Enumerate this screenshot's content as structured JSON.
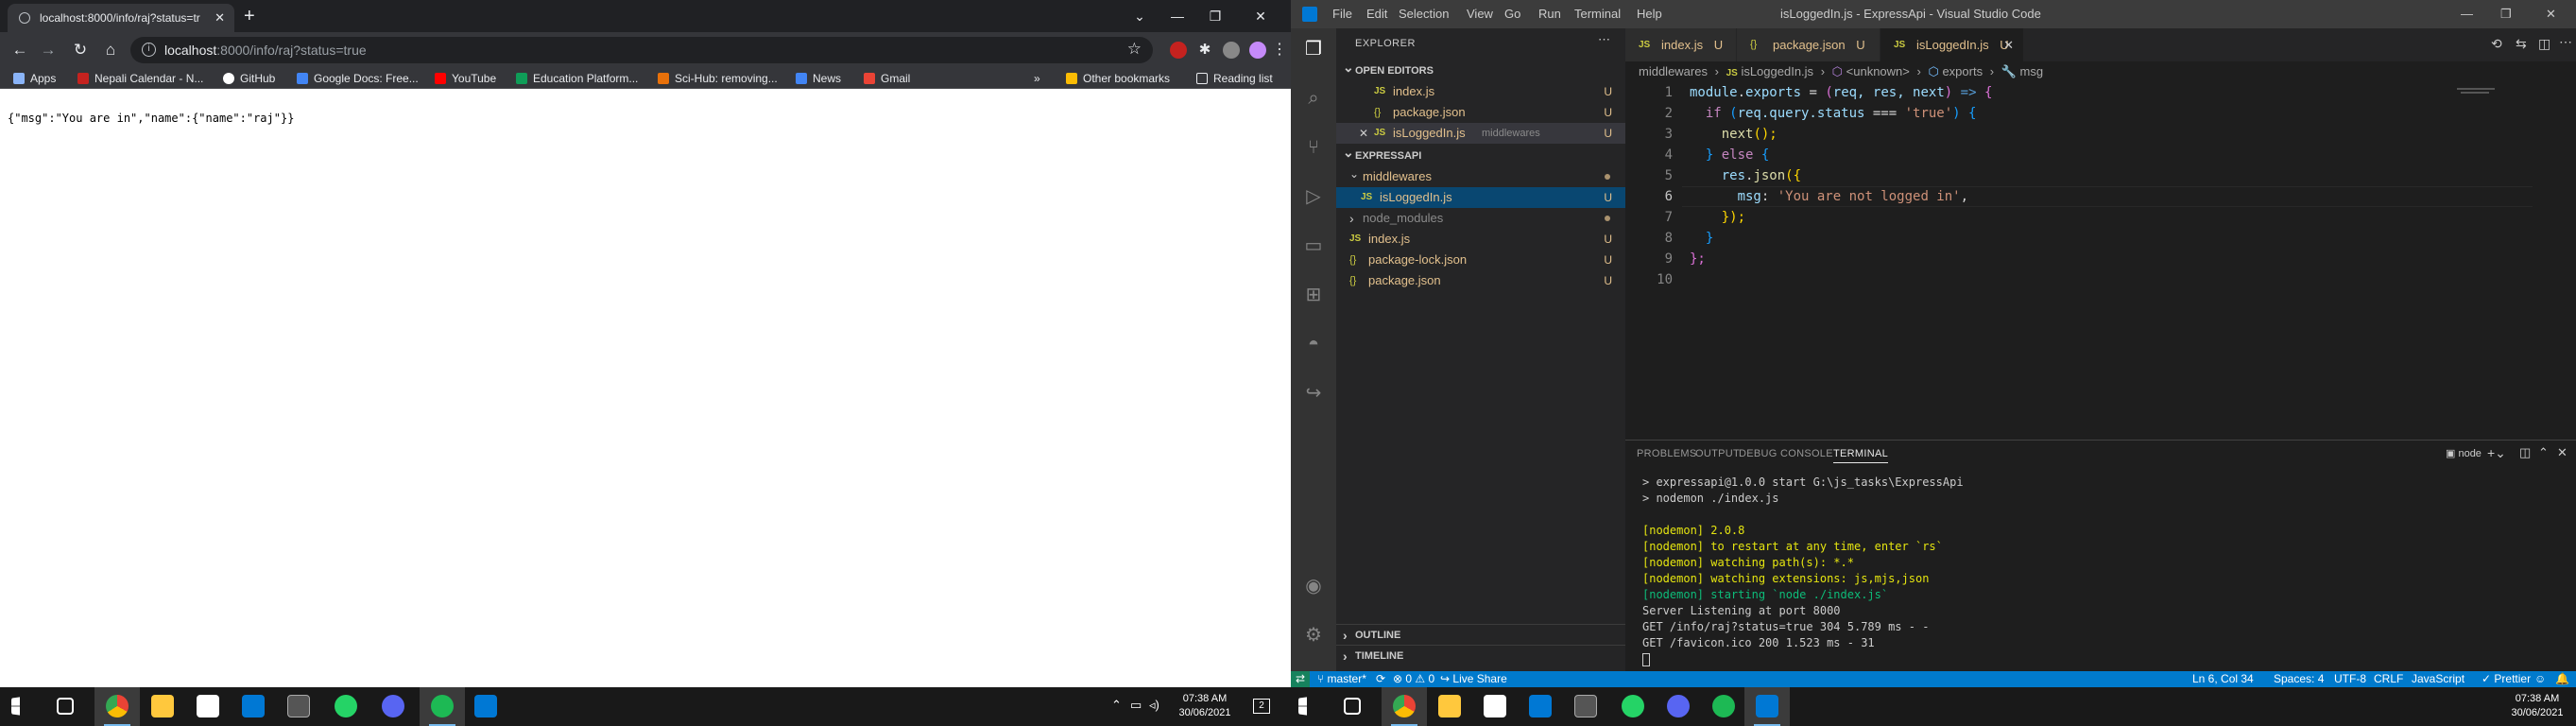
{
  "browser": {
    "tab_title": "localhost:8000/info/raj?status=tr",
    "url_host": "localhost",
    "url_rest": ":8000/info/raj?status=true",
    "bookmarks": [
      {
        "label": "Apps",
        "color": "#8ab4f8"
      },
      {
        "label": "Nepali Calendar - N...",
        "color": "#c5221f"
      },
      {
        "label": "GitHub",
        "color": "#ffffff"
      },
      {
        "label": "Google Docs: Free...",
        "color": "#4285f4"
      },
      {
        "label": "YouTube",
        "color": "#ff0000"
      },
      {
        "label": "Education Platform...",
        "color": "#0f9d58"
      },
      {
        "label": "Sci-Hub: removing...",
        "color": "#e8710a"
      },
      {
        "label": "News",
        "color": "#4285f4"
      },
      {
        "label": "Gmail",
        "color": "#ea4335"
      }
    ],
    "other_bookmarks": "Other bookmarks",
    "reading_list": "Reading list",
    "page_body": "{\"msg\":\"You are in\",\"name\":{\"name\":\"raj\"}}"
  },
  "taskbar_left": {
    "time": "07:38 AM",
    "date": "30/06/2021",
    "notif": "2"
  },
  "taskbar_right": {
    "time": "07:38 AM",
    "date": "30/06/2021"
  },
  "vscode": {
    "title": "isLoggedIn.js - ExpressApi - Visual Studio Code",
    "menu": [
      "File",
      "Edit",
      "Selection",
      "View",
      "Go",
      "Run",
      "Terminal",
      "Help"
    ],
    "explorer_label": "EXPLORER",
    "open_editors_label": "OPEN EDITORS",
    "open_editors": [
      {
        "name": "index.js",
        "type": "JS",
        "badge": "U"
      },
      {
        "name": "package.json",
        "type": "{}",
        "badge": "U"
      },
      {
        "name": "isLoggedIn.js",
        "type": "JS",
        "badge": "U",
        "desc": "middlewares"
      }
    ],
    "project_label": "EXPRESSAPI",
    "tree": [
      {
        "name": "middlewares",
        "type": "folder"
      },
      {
        "name": "isLoggedIn.js",
        "type": "JS",
        "badge": "U"
      },
      {
        "name": "node_modules",
        "type": "folder"
      },
      {
        "name": "index.js",
        "type": "JS",
        "badge": "U"
      },
      {
        "name": "package-lock.json",
        "type": "{}",
        "badge": "U"
      },
      {
        "name": "package.json",
        "type": "{}",
        "badge": "U"
      }
    ],
    "outline_label": "OUTLINE",
    "timeline_label": "TIMELINE",
    "tabs": [
      {
        "name": "index.js",
        "type": "JS",
        "badge": "U"
      },
      {
        "name": "package.json",
        "type": "{}",
        "badge": "U"
      },
      {
        "name": "isLoggedIn.js",
        "type": "JS",
        "badge": "U"
      }
    ],
    "breadcrumb": {
      "folder": "middlewares",
      "file": "isLoggedIn.js",
      "fn": "<unknown>",
      "exports": "exports",
      "msg": "msg"
    },
    "line_numbers": [
      "1",
      "2",
      "3",
      "4",
      "5",
      "6",
      "7",
      "8",
      "9",
      "10"
    ],
    "code": {
      "l1_a": "module",
      "l1_b": ".",
      "l1_c": "exports",
      "l1_d": " = ",
      "l1_e": "(",
      "l1_f": "req, res, next",
      "l1_g": ")",
      "l1_h": " => ",
      "l1_i": "{",
      "l2_a": "if",
      "l2_b": " (",
      "l2_c": "req.query.status",
      "l2_d": " === ",
      "l2_e": "'true'",
      "l2_f": ") {",
      "l3_a": "next",
      "l3_b": "();",
      "l4_a": "} ",
      "l4_b": "else",
      "l4_c": " {",
      "l5_a": "res",
      "l5_b": ".",
      "l5_c": "json",
      "l5_d": "({",
      "l6_a": "msg",
      "l6_b": ": ",
      "l6_c": "'You are not logged in'",
      "l6_d": ",",
      "l7_a": "});",
      "l8_a": "}",
      "l9_a": "};"
    },
    "panel_tabs": [
      "PROBLEMS",
      "OUTPUT",
      "DEBUG CONSOLE",
      "TERMINAL"
    ],
    "terminal_shell": "node",
    "terminal": [
      "> expressapi@1.0.0 start G:\\js_tasks\\ExpressApi",
      "> nodemon ./index.js",
      "",
      "[nodemon] 2.0.8",
      "[nodemon] to restart at any time, enter `rs`",
      "[nodemon] watching path(s): *.*",
      "[nodemon] watching extensions: js,mjs,json",
      "[nodemon] starting `node ./index.js`",
      "Server Listening at port 8000",
      "GET /info/raj?status=true 304 5.789 ms - -",
      "GET /favicon.ico 200 1.523 ms - 31"
    ],
    "status": {
      "branch": "master*",
      "problems": "0",
      "warnings": "0",
      "live_share": "Live Share",
      "position": "Ln 6, Col 34",
      "spaces": "Spaces: 4",
      "encoding": "UTF-8",
      "eol": "CRLF",
      "language": "JavaScript",
      "prettier": "Prettier"
    }
  }
}
